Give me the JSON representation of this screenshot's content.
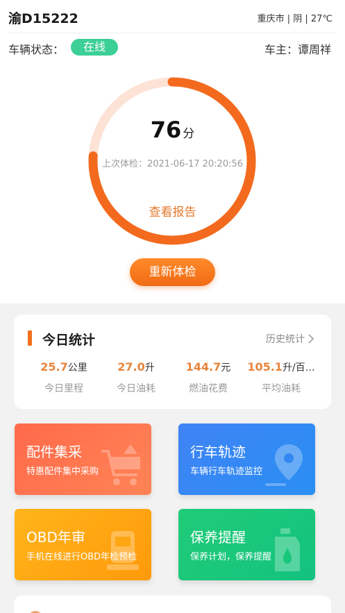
{
  "header": {
    "plate": "渝D15222",
    "location_weather": "重庆市 | 阴 | 27℃",
    "status_label": "车辆状态：",
    "status_value": "在线",
    "owner": "车主：谭周祥"
  },
  "health": {
    "score": "76",
    "score_unit": "分",
    "score_fraction": 0.76,
    "last_check": "上次体检：2021-06-17 20:20:56",
    "view_report": "查看报告",
    "recheck_button": "重新体检"
  },
  "today_stats": {
    "title": "今日统计",
    "history_link": "历史统计",
    "items": [
      {
        "value": "25.7",
        "unit": "公里",
        "label": "今日里程"
      },
      {
        "value": "27.0",
        "unit": "升",
        "label": "今日油耗"
      },
      {
        "value": "144.7",
        "unit": "元",
        "label": "燃油花费"
      },
      {
        "value": "105.1",
        "unit": "升/百…",
        "label": "平均油耗"
      }
    ]
  },
  "tiles": [
    {
      "title": "配件集采",
      "subtitle": "特惠配件集中采购",
      "icon": "shopping-cart-icon"
    },
    {
      "title": "行车轨迹",
      "subtitle": "车辆行车轨迹监控",
      "icon": "map-pin-icon"
    },
    {
      "title": "OBD年审",
      "subtitle": "手机在线进行OBD年检预检",
      "icon": "obd-device-icon"
    },
    {
      "title": "保养提醒",
      "subtitle": "保养计划，保养提醒",
      "icon": "oil-bottle-icon"
    }
  ],
  "colors": {
    "accent_orange": "#f37020",
    "status_green": "#3ccf96",
    "tile_parts": "#ff6a4a",
    "tile_track": "#3f83f6",
    "tile_obd": "#ffb41a",
    "tile_maintenance": "#20cc78"
  }
}
